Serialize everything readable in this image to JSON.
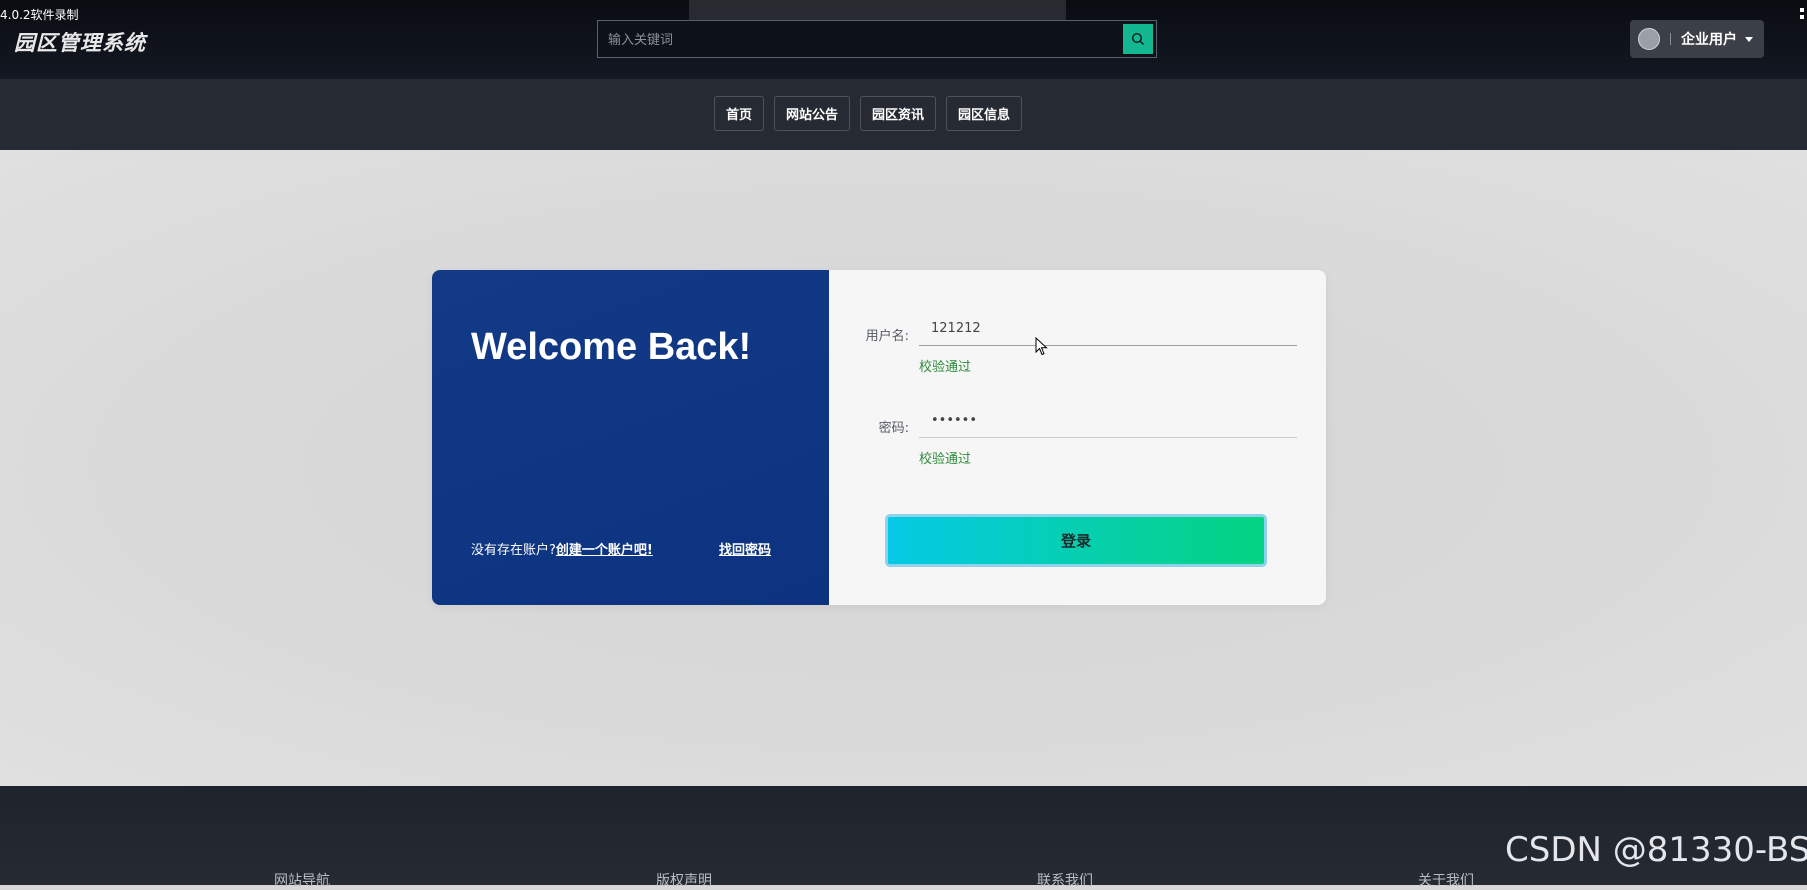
{
  "recorder": {
    "label": "4.0.2软件录制"
  },
  "header": {
    "logo": "园区管理系统",
    "search": {
      "placeholder": "输入关键词",
      "value": ""
    },
    "user_menu": {
      "label": "企业用户"
    }
  },
  "nav": {
    "items": [
      {
        "label": "首页"
      },
      {
        "label": "网站公告"
      },
      {
        "label": "园区资讯"
      },
      {
        "label": "园区信息"
      }
    ]
  },
  "login": {
    "welcome": "Welcome Back!",
    "no_account_text": "没有存在账户?",
    "create_account_link": "创建一个账户吧!",
    "forgot_password_link": "找回密码",
    "username": {
      "label": "用户名:",
      "value": "121212",
      "validation": "校验通过"
    },
    "password": {
      "label": "密码:",
      "value": "••••••",
      "validation": "校验通过"
    },
    "submit_label": "登录"
  },
  "footer": {
    "links": [
      {
        "label": "网站导航"
      },
      {
        "label": "版权声明"
      },
      {
        "label": "联系我们"
      },
      {
        "label": "关于我们"
      }
    ]
  },
  "watermark": "CSDN @81330-BS",
  "colors": {
    "accent": "#14b890",
    "login_panel": "#123a86",
    "valid_text": "#2e8b3c"
  }
}
